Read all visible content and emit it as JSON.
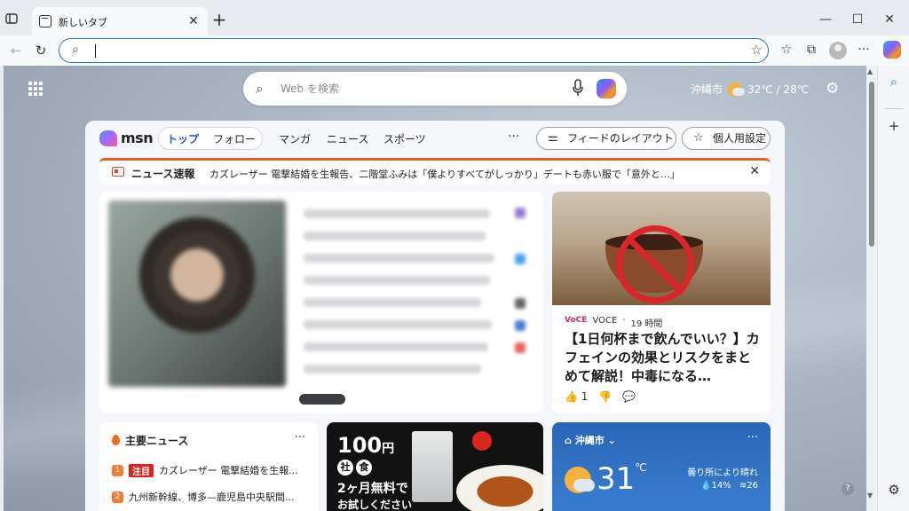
{
  "browser": {
    "tab_title": "新しいタブ",
    "tab_close": "✕",
    "new_tab": "+",
    "window_controls": {
      "minimize": "—",
      "maximize": "☐",
      "close": "✕"
    },
    "address_value": "",
    "nav_icons": [
      "back-icon",
      "refresh-icon"
    ],
    "toolbar_icons": [
      "favorites-star-icon",
      "favorites-icon",
      "screenshot-icon",
      "profile-icon",
      "more-icon",
      "copilot-icon"
    ]
  },
  "page": {
    "search_placeholder": "Web を検索",
    "weather_top": {
      "city": "沖縄市",
      "temps": "32℃ / 28℃"
    }
  },
  "msn": {
    "logo_text": "msn",
    "tabs": [
      {
        "label": "トップ",
        "active": true
      },
      {
        "label": "フォロー",
        "active": false
      },
      {
        "label": "マンガ",
        "active": false
      },
      {
        "label": "ニュース",
        "active": false
      },
      {
        "label": "スポーツ",
        "active": false
      }
    ],
    "more": "···",
    "layout_button": "フィードのレイアウト",
    "personalize_button": "個人用設定",
    "breaking": {
      "label": "ニュース速報",
      "text": "カズレーザー 電撃結婚を生報告、二階堂ふみは「僕よりすべてがしっかり」デートも赤い服で「意外と…」",
      "close": "✕"
    },
    "article": {
      "source": "VOCE",
      "time": "19 時間",
      "headline": "【1日何杯まで飲んでいい？】カフェインの効果とリスクをまとめて解説！中毒になる…",
      "likes": "1"
    },
    "top_news": {
      "title": "主要ニュース",
      "more": "···",
      "items": [
        {
          "num": "1",
          "tag": "注目",
          "text": "カズレーザー 電撃結婚を生報..."
        },
        {
          "num": "2",
          "tag": "",
          "text": "九州新幹線、博多—鹿児島中央駅間..."
        }
      ]
    },
    "ad": {
      "price": "100",
      "yen": "円",
      "badge1": "社",
      "badge2": "食",
      "sub": "2ヶ月無料で",
      "sub2": "お試しください"
    },
    "weather_card": {
      "city": "沖縄市",
      "chevron": "⌄",
      "more": "···",
      "temp": "31",
      "unit": "℃",
      "desc": "曇り所により晴れ",
      "rain": "14%",
      "wind": "26"
    }
  },
  "sidebar": {
    "icons": [
      "search-icon",
      "add-icon",
      "settings-icon"
    ]
  },
  "help": "?"
}
